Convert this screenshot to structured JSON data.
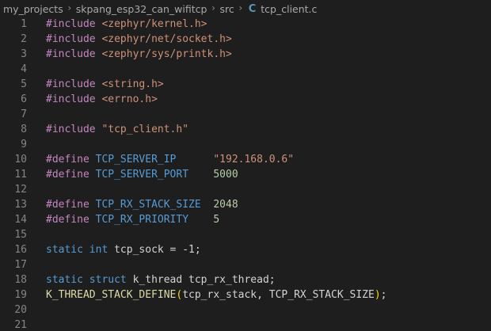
{
  "breadcrumb": {
    "items": [
      "my_projects",
      "skpang_esp32_can_wifitcp",
      "src"
    ],
    "file_icon_label": "C",
    "file_name": "tcp_client.c",
    "separator": "›"
  },
  "colors": {
    "background": "#1e1e1e",
    "line_number": "#858585",
    "directive": "#c586c0",
    "macro": "#569cd6",
    "string": "#ce9178",
    "number": "#b5cea8",
    "keyword": "#569cd6",
    "type": "#4ec9b0",
    "function": "#dcdcaa",
    "bracket": "#ffd700"
  },
  "editor": {
    "lines": [
      {
        "n": "1",
        "tokens": [
          [
            "directive",
            "#include "
          ],
          [
            "header",
            "<zephyr/kernel.h>"
          ]
        ]
      },
      {
        "n": "2",
        "tokens": [
          [
            "directive",
            "#include "
          ],
          [
            "header",
            "<zephyr/net/socket.h>"
          ]
        ]
      },
      {
        "n": "3",
        "tokens": [
          [
            "directive",
            "#include "
          ],
          [
            "header",
            "<zephyr/sys/printk.h>"
          ]
        ]
      },
      {
        "n": "4",
        "tokens": []
      },
      {
        "n": "5",
        "tokens": [
          [
            "directive",
            "#include "
          ],
          [
            "header",
            "<string.h>"
          ]
        ]
      },
      {
        "n": "6",
        "tokens": [
          [
            "directive",
            "#include "
          ],
          [
            "header",
            "<errno.h>"
          ]
        ]
      },
      {
        "n": "7",
        "tokens": []
      },
      {
        "n": "8",
        "tokens": [
          [
            "directive",
            "#include "
          ],
          [
            "header",
            "\"tcp_client.h\""
          ]
        ]
      },
      {
        "n": "9",
        "tokens": []
      },
      {
        "n": "10",
        "tokens": [
          [
            "directive",
            "#define "
          ],
          [
            "macro",
            "TCP_SERVER_IP"
          ],
          [
            "plain",
            "      "
          ],
          [
            "string",
            "\"192.168.0.6\""
          ]
        ]
      },
      {
        "n": "11",
        "tokens": [
          [
            "directive",
            "#define "
          ],
          [
            "macro",
            "TCP_SERVER_PORT"
          ],
          [
            "plain",
            "    "
          ],
          [
            "number",
            "5000"
          ]
        ]
      },
      {
        "n": "12",
        "tokens": []
      },
      {
        "n": "13",
        "tokens": [
          [
            "directive",
            "#define "
          ],
          [
            "macro",
            "TCP_RX_STACK_SIZE"
          ],
          [
            "plain",
            "  "
          ],
          [
            "number",
            "2048"
          ]
        ]
      },
      {
        "n": "14",
        "tokens": [
          [
            "directive",
            "#define "
          ],
          [
            "macro",
            "TCP_RX_PRIORITY"
          ],
          [
            "plain",
            "    "
          ],
          [
            "number",
            "5"
          ]
        ]
      },
      {
        "n": "15",
        "tokens": []
      },
      {
        "n": "16",
        "tokens": [
          [
            "keyword",
            "static "
          ],
          [
            "keyword",
            "int "
          ],
          [
            "plain",
            "tcp_sock = -1;"
          ]
        ]
      },
      {
        "n": "17",
        "tokens": []
      },
      {
        "n": "18",
        "tokens": [
          [
            "keyword",
            "static "
          ],
          [
            "keyword",
            "struct "
          ],
          [
            "plain",
            "k_thread tcp_rx_thread;"
          ]
        ]
      },
      {
        "n": "19",
        "tokens": [
          [
            "func",
            "K_THREAD_STACK_DEFINE"
          ],
          [
            "bracket",
            "("
          ],
          [
            "plain",
            "tcp_rx_stack, TCP_RX_STACK_SIZE"
          ],
          [
            "bracket",
            ")"
          ],
          [
            "plain",
            ";"
          ]
        ]
      },
      {
        "n": "20",
        "tokens": []
      },
      {
        "n": "21",
        "tokens": []
      }
    ]
  }
}
